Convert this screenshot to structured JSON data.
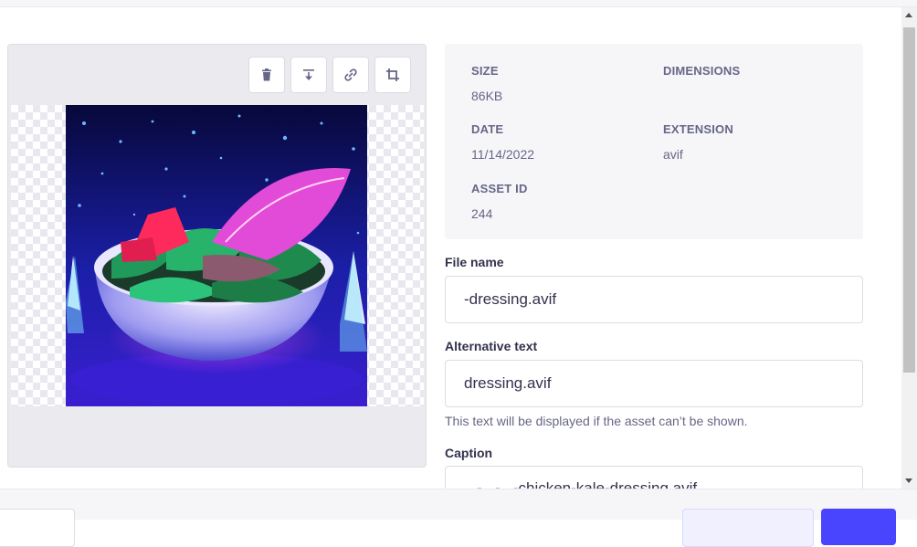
{
  "toolbar": {
    "delete_icon": "trash-icon",
    "download_icon": "download-icon",
    "copy_link_icon": "link-icon",
    "crop_icon": "crop-icon"
  },
  "info": {
    "size_label": "SIZE",
    "size_value": "86KB",
    "dimensions_label": "DIMENSIONS",
    "dimensions_value": "",
    "date_label": "DATE",
    "date_value": "11/14/2022",
    "extension_label": "EXTENSION",
    "extension_value": "avif",
    "asset_id_label": "ASSET ID",
    "asset_id_value": "244"
  },
  "form": {
    "file_name_label": "File name",
    "file_name_value": "-dressing.avif",
    "alt_text_label": "Alternative text",
    "alt_text_value": "dressing.avif",
    "alt_text_hint": "This text will be displayed if the asset can’t be shown.",
    "caption_label": "Caption",
    "caption_value": "...-...-...-chicken-kale-dressing.avif"
  },
  "colors": {
    "primary": "#4945ff",
    "panel_bg": "#f6f6f9",
    "border": "#dcdce4"
  }
}
